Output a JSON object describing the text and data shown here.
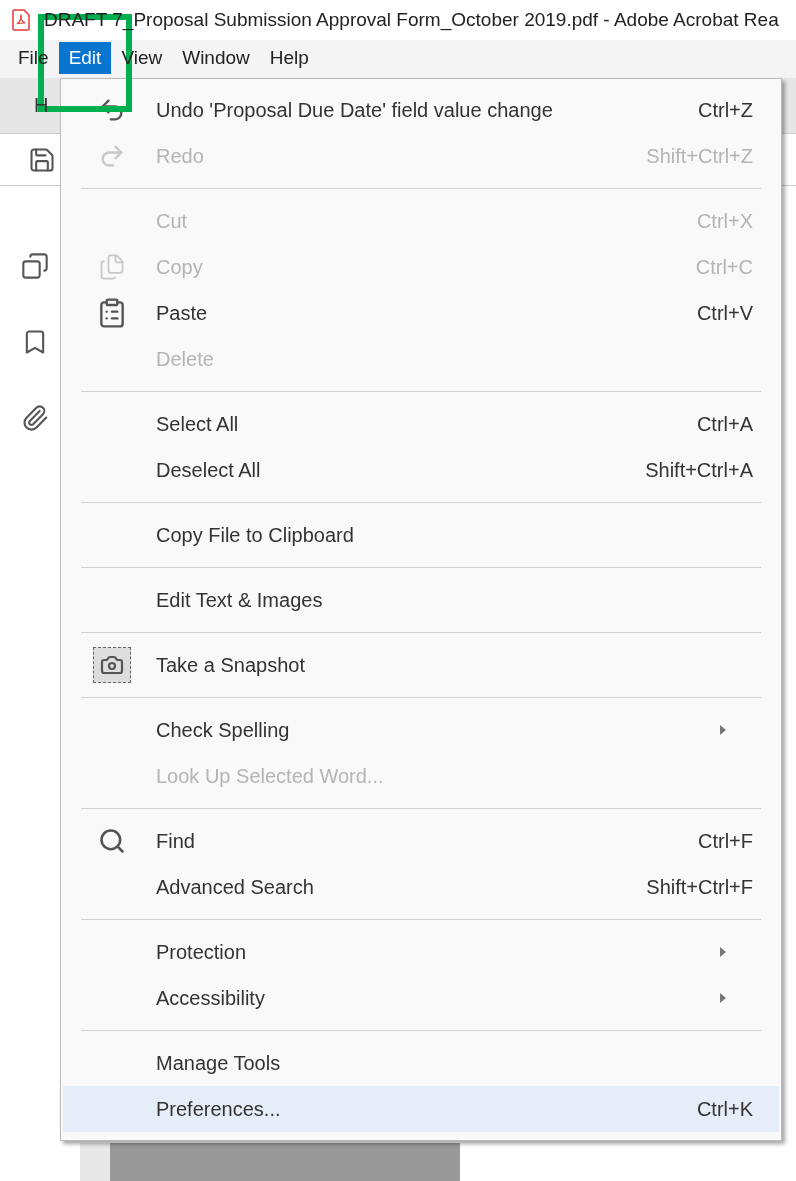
{
  "window": {
    "title": "DRAFT 7_Proposal Submission Approval Form_October 2019.pdf - Adobe Acrobat Rea"
  },
  "menu_bar": [
    {
      "label": "File",
      "selected": false
    },
    {
      "label": "Edit",
      "selected": true
    },
    {
      "label": "View",
      "selected": false
    },
    {
      "label": "Window",
      "selected": false
    },
    {
      "label": "Help",
      "selected": false
    }
  ],
  "tab": {
    "label": "H"
  },
  "edit_menu": [
    {
      "items": [
        {
          "label": "Undo 'Proposal Due Date' field value change",
          "shortcut": "Ctrl+Z",
          "disabled": false,
          "selected": false
        },
        {
          "label": "Redo",
          "shortcut": "Shift+Ctrl+Z",
          "disabled": true,
          "selected": false
        }
      ]
    },
    {
      "items": [
        {
          "label": "Cut",
          "shortcut": "Ctrl+X",
          "disabled": true,
          "selected": false
        },
        {
          "label": "Copy",
          "shortcut": "Ctrl+C",
          "disabled": true,
          "selected": false
        },
        {
          "label": "Paste",
          "shortcut": "Ctrl+V",
          "disabled": false,
          "selected": false
        },
        {
          "label": "Delete",
          "disabled": true,
          "selected": false
        }
      ]
    },
    {
      "items": [
        {
          "label": "Select All",
          "shortcut": "Ctrl+A",
          "disabled": false,
          "selected": false
        },
        {
          "label": "Deselect All",
          "shortcut": "Shift+Ctrl+A",
          "disabled": false,
          "selected": false
        }
      ]
    },
    {
      "items": [
        {
          "label": "Copy File to Clipboard",
          "disabled": false,
          "selected": false
        }
      ]
    },
    {
      "items": [
        {
          "label": "Edit Text & Images",
          "disabled": false,
          "selected": false
        }
      ]
    },
    {
      "items": [
        {
          "label": "Take a Snapshot",
          "disabled": false,
          "selected": false
        }
      ]
    },
    {
      "items": [
        {
          "label": "Check Spelling",
          "submenu": true,
          "disabled": false,
          "selected": false
        },
        {
          "label": "Look Up Selected Word...",
          "disabled": true,
          "selected": false
        }
      ]
    },
    {
      "items": [
        {
          "label": "Find",
          "shortcut": "Ctrl+F",
          "disabled": false,
          "selected": false
        },
        {
          "label": "Advanced Search",
          "shortcut": "Shift+Ctrl+F",
          "disabled": false,
          "selected": false
        }
      ]
    },
    {
      "items": [
        {
          "label": "Protection",
          "submenu": true,
          "disabled": false,
          "selected": false
        },
        {
          "label": "Accessibility",
          "submenu": true,
          "disabled": false,
          "selected": false
        }
      ]
    },
    {
      "items": [
        {
          "label": "Manage Tools",
          "disabled": false,
          "selected": false
        },
        {
          "label": "Preferences...",
          "shortcut": "Ctrl+K",
          "disabled": false,
          "selected": true
        }
      ]
    }
  ]
}
